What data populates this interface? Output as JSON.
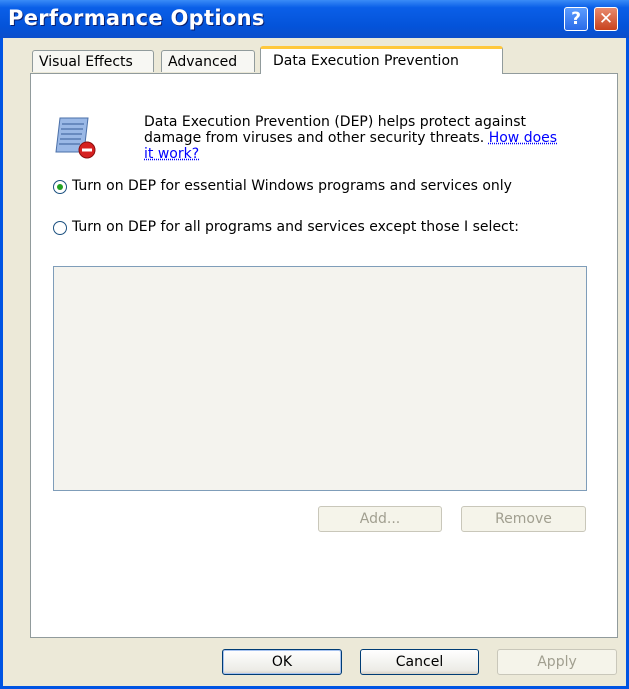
{
  "window": {
    "title": "Performance Options",
    "help_icon": "question-mark",
    "close_icon": "x"
  },
  "tabs": [
    {
      "label": "Visual Effects",
      "selected": false
    },
    {
      "label": "Advanced",
      "selected": false
    },
    {
      "label": "Data Execution Prevention",
      "selected": true
    }
  ],
  "dep": {
    "icon": "dep-shield-binary-icon",
    "description": "Data Execution Prevention (DEP) helps protect against damage from viruses and other security threats.",
    "link": "How does it work?",
    "options": [
      {
        "label": "Turn on DEP for essential Windows programs and services only",
        "selected": true
      },
      {
        "label": "Turn on DEP for all programs and services except those I select:",
        "selected": false
      }
    ],
    "add_label": "Add...",
    "remove_label": "Remove"
  },
  "footer": {
    "ok_label": "OK",
    "cancel_label": "Cancel",
    "apply_label": "Apply"
  },
  "colors": {
    "title_bar": "#0A5FE8",
    "window_bg": "#ECE9D8",
    "selected_tab_accent": "#FFC83C",
    "link": "#0000FF",
    "radio_dot": "#21A121"
  }
}
